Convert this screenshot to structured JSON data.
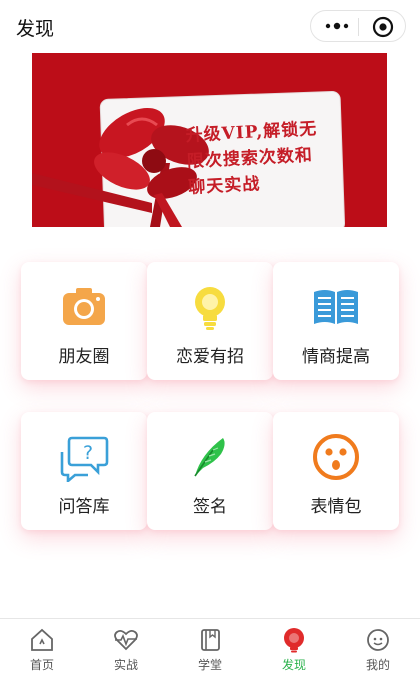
{
  "navbar": {
    "title": "发现"
  },
  "banner": {
    "lines": [
      "升级VIP,解锁无",
      "限次搜索次数和",
      "聊天实战"
    ]
  },
  "grid": {
    "items": [
      {
        "label": "朋友圈",
        "icon": "camera-icon"
      },
      {
        "label": "恋爱有招",
        "icon": "lightbulb-icon"
      },
      {
        "label": "情商提高",
        "icon": "book-icon"
      },
      {
        "label": "问答库",
        "icon": "question-chat-icon"
      },
      {
        "label": "签名",
        "icon": "feather-icon"
      },
      {
        "label": "表情包",
        "icon": "surprised-face-icon"
      }
    ]
  },
  "tabbar": {
    "items": [
      {
        "label": "首页",
        "icon": "home-icon"
      },
      {
        "label": "实战",
        "icon": "heartbeat-icon"
      },
      {
        "label": "学堂",
        "icon": "notebook-icon"
      },
      {
        "label": "发现",
        "icon": "bulb-discover-icon"
      },
      {
        "label": "我的",
        "icon": "profile-icon"
      }
    ],
    "active_color": "#2bb24c"
  },
  "colors": {
    "accent": "#2bb24c",
    "banner_red": "#c8101b",
    "card_shadow": "#f0506e"
  }
}
